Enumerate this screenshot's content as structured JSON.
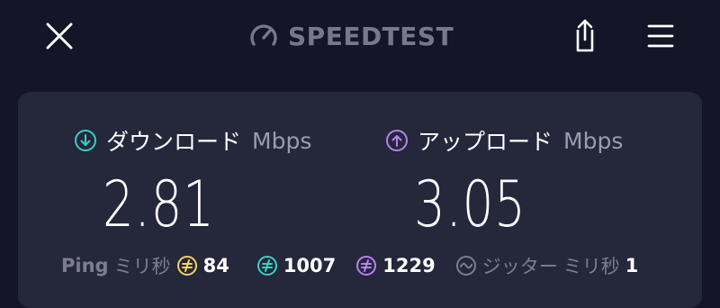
{
  "header": {
    "brand": "SPEEDTEST",
    "icons": [
      "close-icon",
      "speedometer-icon",
      "share-icon",
      "menu-icon"
    ]
  },
  "download": {
    "label": "ダウンロード",
    "unit": "Mbps",
    "value": "2.81",
    "icon": "download-arrow-icon"
  },
  "upload": {
    "label": "アップロード",
    "unit": "Mbps",
    "value": "3.05",
    "icon": "upload-arrow-icon"
  },
  "ping": {
    "label": "Ping",
    "unit": "ミリ秒",
    "idle": "84",
    "download": "1007",
    "upload": "1229"
  },
  "jitter": {
    "label": "ジッター",
    "unit": "ミリ秒",
    "value": "1"
  },
  "colors": {
    "background": "#141526",
    "card": "#25273b",
    "download_accent": "#37d1c3",
    "upload_accent": "#b682f0",
    "idle_ping_accent": "#f4d35e",
    "muted_text": "#7c7e90"
  }
}
